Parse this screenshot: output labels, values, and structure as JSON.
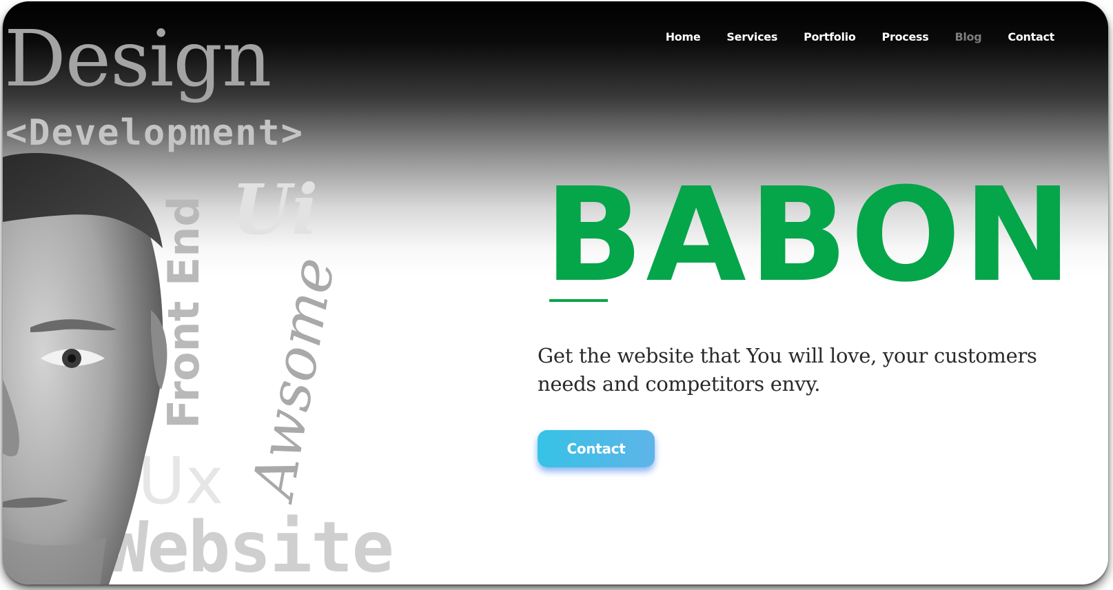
{
  "nav": {
    "items": [
      {
        "label": "Home",
        "muted": false
      },
      {
        "label": "Services",
        "muted": false
      },
      {
        "label": "Portfolio",
        "muted": false
      },
      {
        "label": "Process",
        "muted": false
      },
      {
        "label": "Blog",
        "muted": true
      },
      {
        "label": "Contact",
        "muted": false
      }
    ]
  },
  "wordcloud": {
    "design": "Design",
    "development": "<Development>",
    "ui": "Ui",
    "front_end": "Front End",
    "awsome": "Awsome",
    "ux": "Ux",
    "website": "Website"
  },
  "hero": {
    "title": "BABON",
    "subtitle": "Get the website that You will love, your customers needs and competitors envy.",
    "cta_label": "Contact"
  },
  "colors": {
    "brand_green": "#05a54a",
    "cta_start": "#36c2e6",
    "cta_end": "#5fb4e8",
    "nav_text": "#ffffff",
    "nav_muted": "#7d7d7d"
  }
}
